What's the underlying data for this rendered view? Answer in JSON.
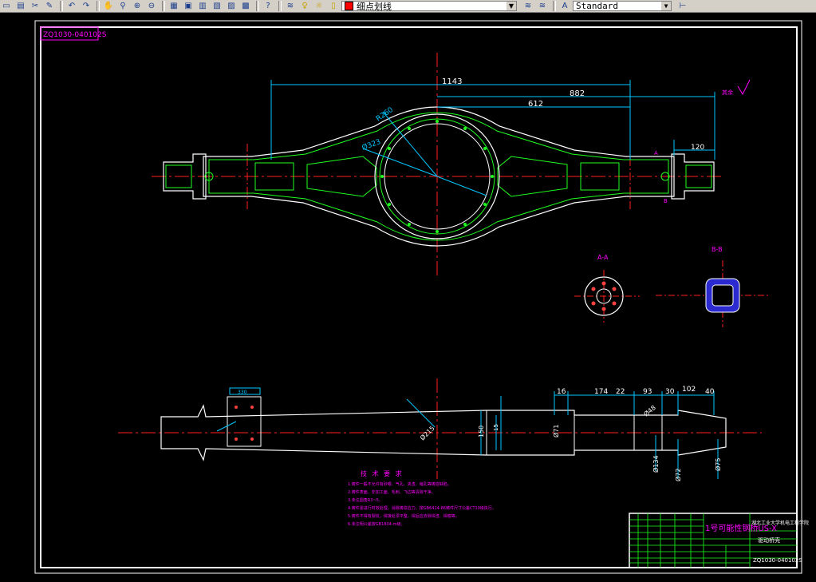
{
  "toolbar": {
    "layer_name": "细点划线",
    "text_style": "Standard",
    "help_icon": "?",
    "icons": [
      "open-icon",
      "save-icon",
      "cut-icon",
      "match-properties-icon",
      "undo-icon",
      "redo-icon",
      "pan-icon",
      "zoom-realtime-icon",
      "zoom-window-icon",
      "zoom-previous-icon",
      "properties-icon",
      "design-center-icon",
      "tool-palettes-icon",
      "sheet-set-icon",
      "markup-icon",
      "calculator-icon",
      "help-icon",
      "layer-manager-icon",
      "layer-state-icons",
      "layer-previous-icon",
      "text-style-icon",
      "dimension-style-icon"
    ]
  },
  "drawing": {
    "frame_code": "ZQ1030-040102S",
    "top_dims": {
      "overall": "1143",
      "mid": "882",
      "inner": "612",
      "right": "120",
      "r_outer": "R260",
      "d_inner": "Ø323",
      "roughness": "其余"
    },
    "section_labels": [
      "A-A",
      "B-B"
    ],
    "bottom_dims": {
      "d16": "16",
      "d174": "174",
      "d22": "22",
      "d93": "93",
      "d30": "30",
      "d102": "102",
      "d40": "40",
      "h150": "150",
      "h15": "15",
      "d71": "Ø71",
      "d134": "Ø134",
      "d72": "Ø72",
      "d75": "Ø75",
      "d215": "Ø215",
      "d48": "Ø48",
      "left_box": "330"
    },
    "tech_title": "技 术 要 求",
    "tech_notes": [
      "1.铸件一般不允许有砂眼、气孔、夹渣、缩孔等铸造缺陷。",
      "2.铸件表面、非加工面、毛刺、飞边等清除干净。",
      "3.未注圆角R3~5。",
      "4.铸件需进行时效处理，消除铸造应力。按GB6414-86铸件尺寸公差CT10级执行。",
      "5.铸件不得有裂纹，焊接处须平整，焊后应去除焊渣、焊瘤等。",
      "6.未注明公差按GB1804-m级。"
    ],
    "title_block": {
      "part_name": "1号可能性钢桥US-X",
      "school": "湖北工业大学机电工程学院",
      "drawing_no": "ZQ1030-040102S",
      "sheet_title": "驱动桥壳"
    }
  }
}
